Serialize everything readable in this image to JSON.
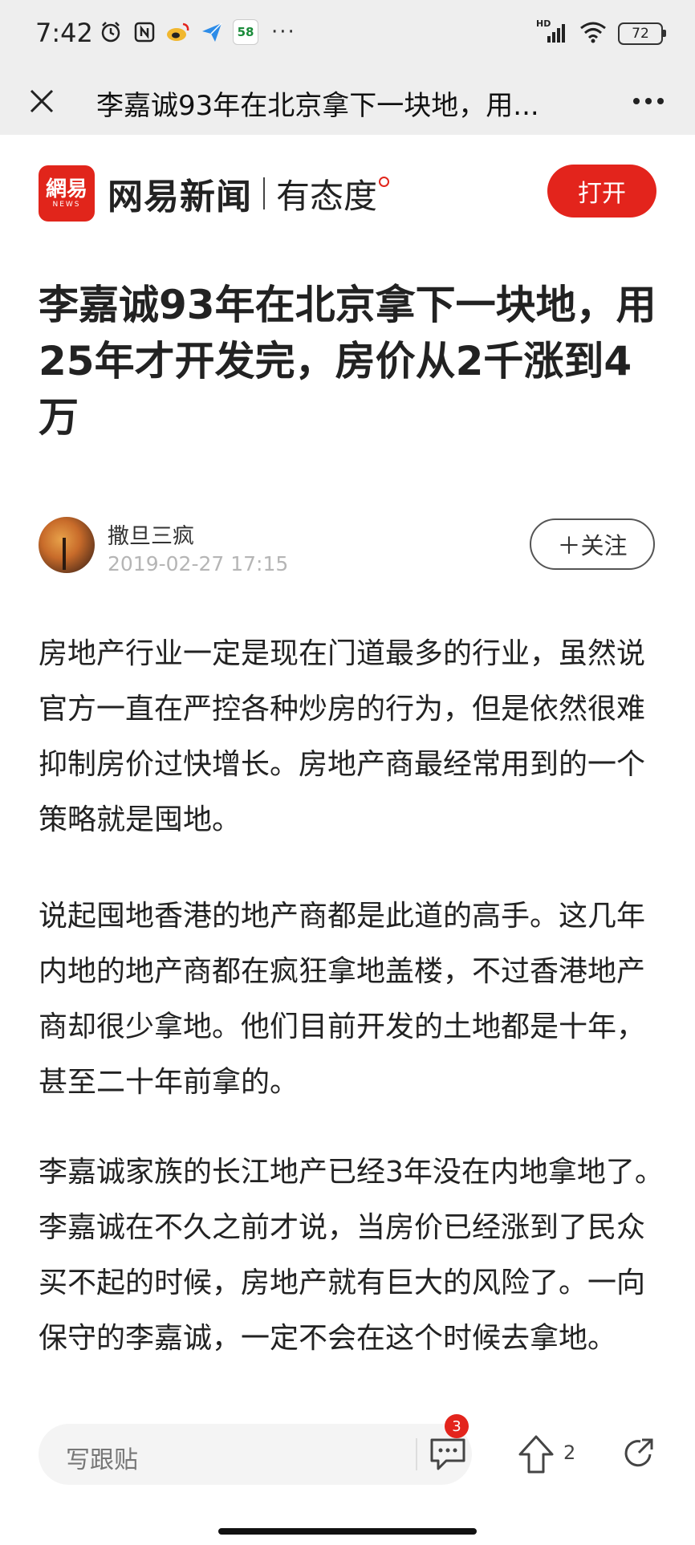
{
  "status_bar": {
    "time": "7:42",
    "app58_label": "58",
    "more_dots": "···",
    "network_label": "HD",
    "battery": "72"
  },
  "title_bar": {
    "title": "李嘉诚93年在北京拿下一块地，用..."
  },
  "brand": {
    "logo_line1": "網易",
    "logo_line2": "NEWS",
    "name": "网易新闻",
    "slogan": "有态度",
    "open_label": "打开"
  },
  "article": {
    "headline": "李嘉诚93年在北京拿下一块地，用25年才开发完，房价从2千涨到4万",
    "author": "撒旦三疯",
    "time": "2019-02-27 17:15",
    "follow_label": "＋关注",
    "paragraphs": [
      "房地产行业一定是现在门道最多的行业，虽然说官方一直在严控各种炒房的行为，但是依然很难抑制房价过快增长。房地产商最经常用到的一个策略就是囤地。",
      "说起囤地香港的地产商都是此道的高手。这几年内地的地产商都在疯狂拿地盖楼，不过香港地产商却很少拿地。他们目前开发的土地都是十年，甚至二十年前拿的。",
      "李嘉诚家族的长江地产已经3年没在内地拿地了。李嘉诚在不久之前才说，当房价已经涨到了民众买不起的时候，房地产就有巨大的风险了。一向保守的李嘉诚，一定不会在这个时候去拿地。"
    ]
  },
  "bottom_bar": {
    "comment_placeholder": "写跟贴",
    "comment_badge": "3",
    "vote_count": "2"
  },
  "colors": {
    "accent": "#e3241c",
    "status_bar_bg": "#eeeeee",
    "muted_text": "#b5b5b5"
  }
}
